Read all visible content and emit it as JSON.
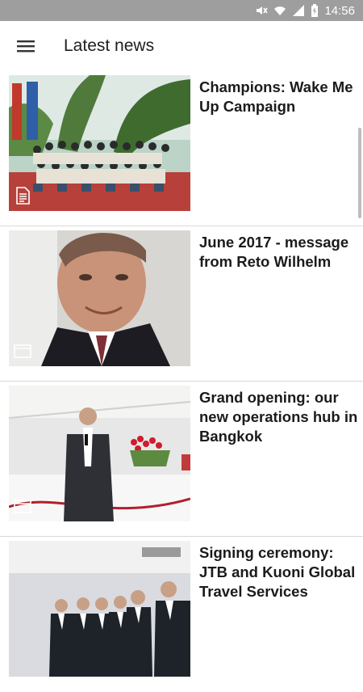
{
  "status_bar": {
    "time": "14:56",
    "icons": [
      "mute-icon",
      "wifi-icon",
      "signal-icon",
      "battery-icon"
    ]
  },
  "app_bar": {
    "title": "Latest news",
    "menu_icon": "hamburger-menu-icon"
  },
  "articles": [
    {
      "headline": "Champions: Wake Me Up Campaign",
      "type_icon": "document-icon",
      "image": "group-photo-outdoors"
    },
    {
      "headline": "June 2017 - message from Reto Wilhelm",
      "type_icon": "video-icon",
      "image": "portrait-man-suit"
    },
    {
      "headline": "Grand opening: our new operations hub in Bangkok",
      "type_icon": "video-icon",
      "image": "speaker-at-opening"
    },
    {
      "headline": "Signing ceremony: JTB and Kuoni Global Travel Services",
      "type_icon": "",
      "image": "men-in-suits-ceremony"
    }
  ],
  "colors": {
    "status_bar": "#9e9e9e",
    "text": "#1b1b1b",
    "divider": "#d9d9d9"
  }
}
